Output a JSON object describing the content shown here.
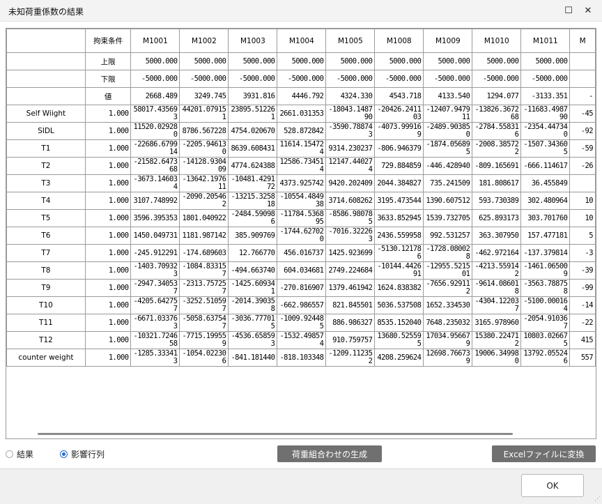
{
  "window": {
    "title": "未知荷重係数の結果",
    "maximize_glyph": "☐",
    "close_glyph": "✕"
  },
  "table": {
    "corner": "",
    "constraint_header": "拘束条件",
    "columns": [
      "M1001",
      "M1002",
      "M1003",
      "M1004",
      "M1005",
      "M1008",
      "M1009",
      "M1010",
      "M1011",
      "M"
    ],
    "bound_rows": [
      {
        "label": "上限",
        "values": [
          "5000.000",
          "5000.000",
          "5000.000",
          "5000.000",
          "5000.000",
          "5000.000",
          "5000.000",
          "5000.000",
          "5000.000",
          ""
        ]
      },
      {
        "label": "下限",
        "values": [
          "-5000.000",
          "-5000.000",
          "-5000.000",
          "-5000.000",
          "-5000.000",
          "-5000.000",
          "-5000.000",
          "-5000.000",
          "-5000.000",
          ""
        ]
      },
      {
        "label": "値",
        "values": [
          "2668.489",
          "3249.745",
          "3931.816",
          "4446.792",
          "4324.330",
          "4543.718",
          "4133.540",
          "1294.077",
          "-3133.351",
          "-"
        ]
      }
    ],
    "load_rows": [
      {
        "name": "Self Wiight",
        "coef": "1.000",
        "values": [
          "58017.435693",
          "44201.079151",
          "23895.512261",
          "2661.031353",
          "-18043.148790",
          "-20426.241103",
          "-12407.947911",
          "-13826.367268",
          "-11683.498790",
          "-45"
        ]
      },
      {
        "name": "SIDL",
        "coef": "1.000",
        "values": [
          "11520.029280",
          "8786.567228",
          "4754.020670",
          "528.872842",
          "-3590.788743",
          "-4073.999169",
          "-2489.903850",
          "-2784.558316",
          "-2354.447340",
          "-92"
        ]
      },
      {
        "name": "T1",
        "coef": "1.000",
        "values": [
          "-22686.679914",
          "-2205.946130",
          "8639.608431",
          "11614.154724",
          "9314.230237",
          "-806.946379",
          "-1874.056895",
          "-2008.385722",
          "-1507.343605",
          "-59"
        ]
      },
      {
        "name": "T2",
        "coef": "1.000",
        "values": [
          "-21582.647368",
          "-14128.930409",
          "4774.624388",
          "12586.734514",
          "12147.440274",
          "729.884859",
          "-446.428940",
          "-809.165691",
          "-666.114617",
          "-26"
        ]
      },
      {
        "name": "T3",
        "coef": "1.000",
        "values": [
          "-3673.146034",
          "-13642.197611",
          "-10481.429172",
          "4373.925742",
          "9420.202409",
          "2044.384827",
          "735.241509",
          "181.808617",
          "36.455849",
          ""
        ]
      },
      {
        "name": "T4",
        "coef": "1.000",
        "values": [
          "3107.748992",
          "-2090.205462",
          "-13215.325818",
          "-10554.484938",
          "3714.608262",
          "3195.473544",
          "1390.607512",
          "593.730389",
          "302.480964",
          "10"
        ]
      },
      {
        "name": "T5",
        "coef": "1.000",
        "values": [
          "3596.395353",
          "1801.040922",
          "-2484.590986",
          "-11784.536895",
          "-8586.980785",
          "3633.852945",
          "1539.732705",
          "625.893173",
          "303.701760",
          "10"
        ]
      },
      {
        "name": "T6",
        "coef": "1.000",
        "values": [
          "1450.049731",
          "1181.987142",
          "385.909769",
          "-1744.627020",
          "-7016.322263",
          "2436.559958",
          "992.531257",
          "363.307950",
          "157.477181",
          "5"
        ]
      },
      {
        "name": "T7",
        "coef": "1.000",
        "values": [
          "-245.912291",
          "-174.689603",
          "12.766770",
          "456.016737",
          "1425.923699",
          "-5130.121786",
          "-1728.080028",
          "-462.972164",
          "-137.379814",
          "-3"
        ]
      },
      {
        "name": "T8",
        "coef": "1.000",
        "values": [
          "-1403.709323",
          "-1084.833157",
          "-494.663740",
          "604.034681",
          "2749.224684",
          "-10144.442691",
          "-12955.521501",
          "-4213.559142",
          "-1461.065009",
          "-39"
        ]
      },
      {
        "name": "T9",
        "coef": "1.000",
        "values": [
          "-2947.340537",
          "-2313.757257",
          "-1425.609341",
          "-270.816907",
          "1379.461942",
          "1624.838382",
          "-7656.929112",
          "-9614.086018",
          "-3563.788758",
          "-99"
        ]
      },
      {
        "name": "T10",
        "coef": "1.000",
        "values": [
          "-4205.642757",
          "-3252.510597",
          "-2014.390358",
          "-662.986557",
          "821.845501",
          "5036.537508",
          "1652.334530",
          "-4304.122037",
          "-5100.000164",
          "-14"
        ]
      },
      {
        "name": "T11",
        "coef": "1.000",
        "values": [
          "-6671.033763",
          "-5058.637547",
          "-3036.777015",
          "-1009.924485",
          "886.986327",
          "8535.152040",
          "7648.235032",
          "3165.978960",
          "-2054.910367",
          "-22"
        ]
      },
      {
        "name": "T12",
        "coef": "1.000",
        "values": [
          "-10321.724658",
          "-7715.199559",
          "-4536.658593",
          "-1532.498574",
          "910.759757",
          "13680.525595",
          "17034.956679",
          "15380.224712",
          "10803.026675",
          "415"
        ]
      },
      {
        "name": "counter weight",
        "coef": "1.000",
        "values": [
          "-1285.333413",
          "-1054.022306",
          "-841.181440",
          "-818.103348",
          "-1209.112352",
          "4208.259624",
          "12698.766739",
          "19006.349980",
          "13792.055246",
          "557"
        ]
      }
    ]
  },
  "view_options": {
    "result_label": "結果",
    "influence_label": "影響行列",
    "selected": "影響行列"
  },
  "buttons": {
    "generate_combinations": "荷重組合わせの生成",
    "export_excel": "Excelファイルに変換",
    "ok": "OK"
  }
}
